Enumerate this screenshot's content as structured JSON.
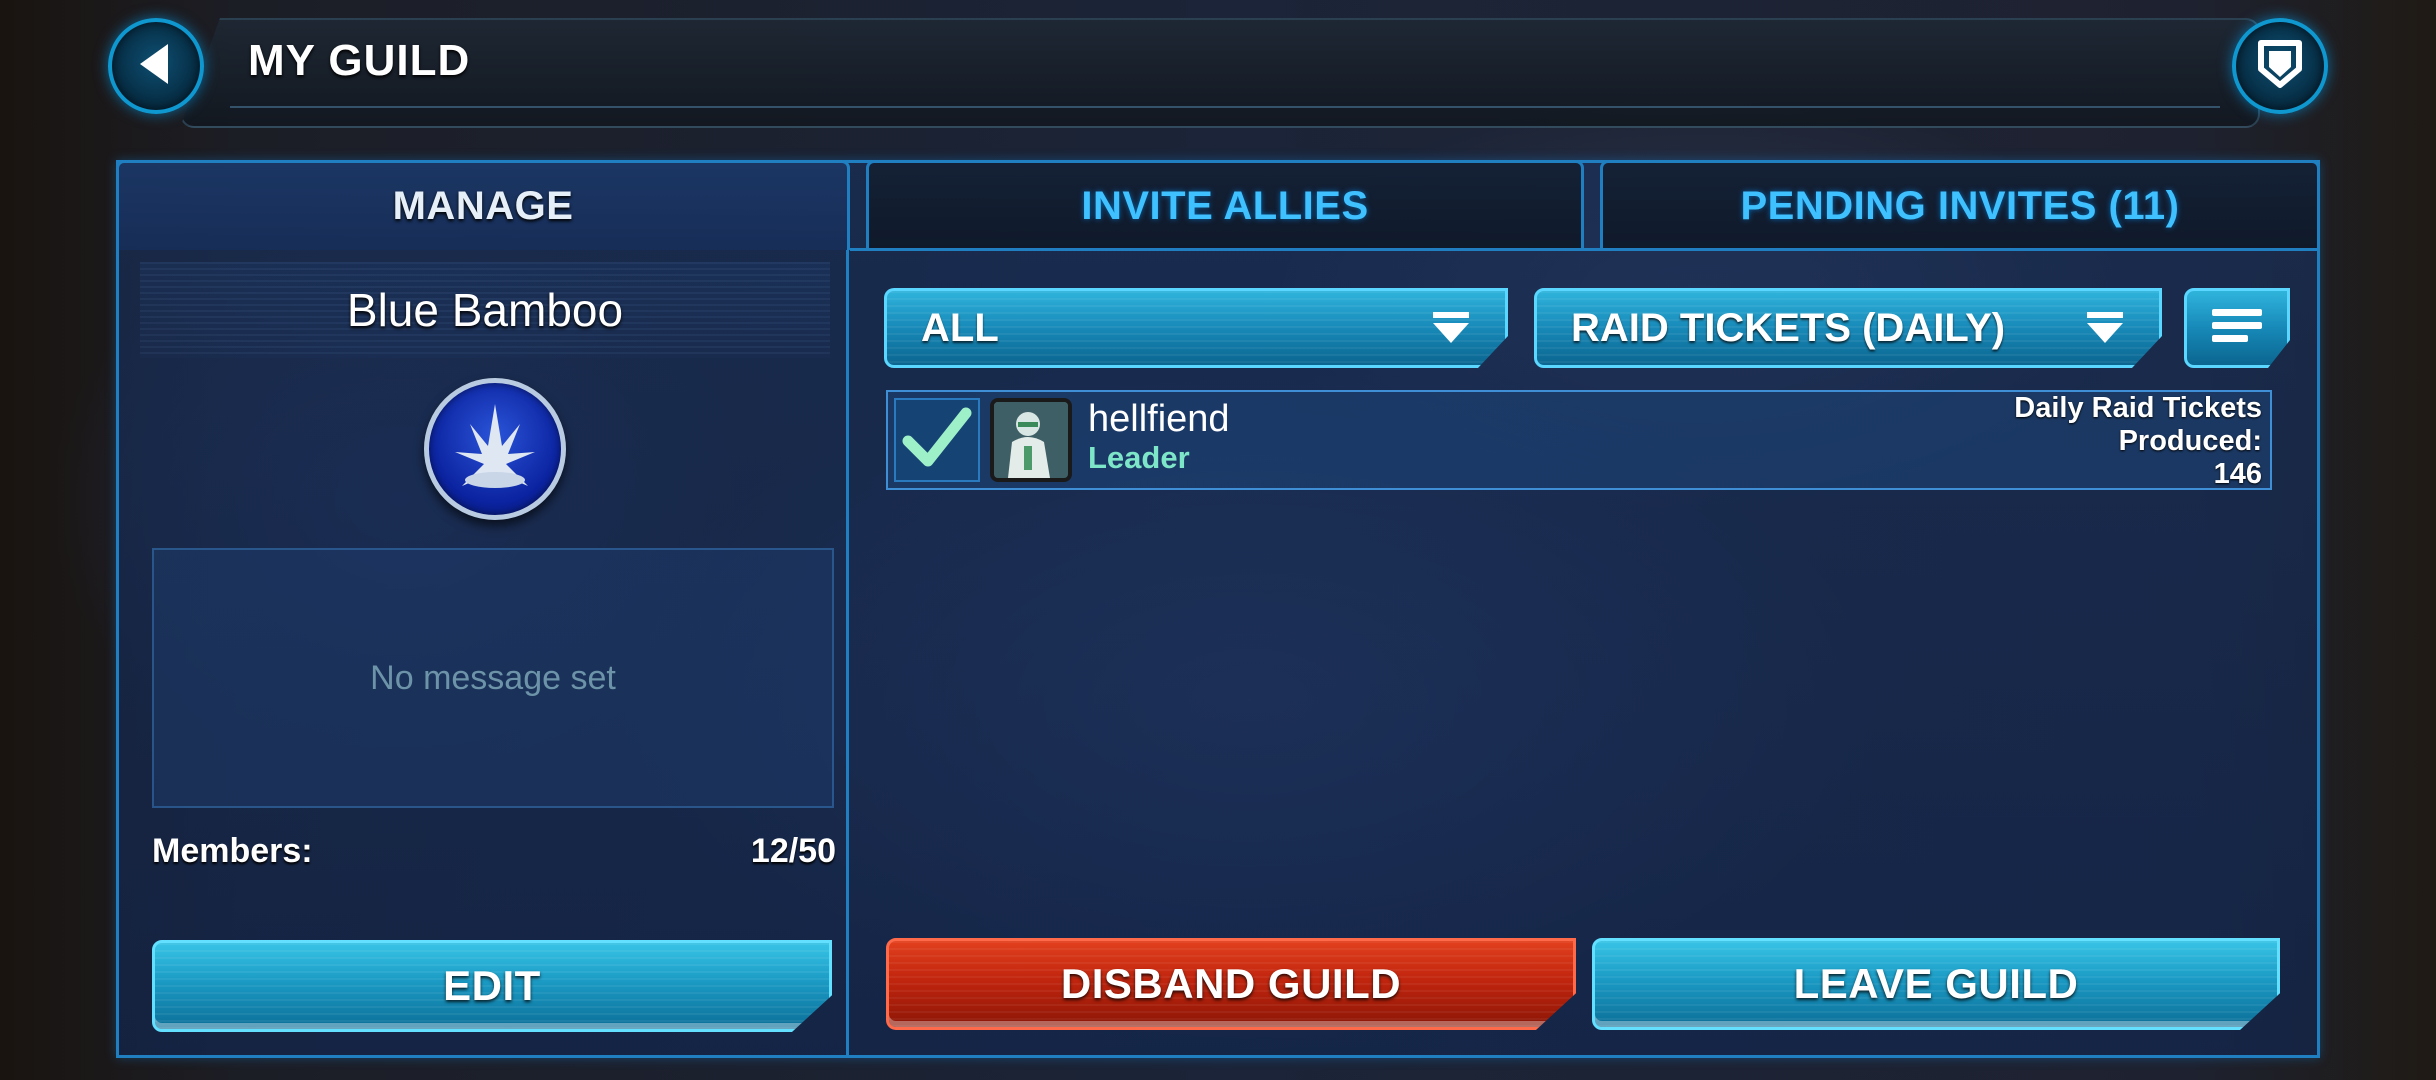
{
  "header": {
    "title": "MY GUILD",
    "back_icon": "back-arrow-icon",
    "shield_icon": "shield-icon"
  },
  "tabs": [
    {
      "label": "MANAGE",
      "active": true
    },
    {
      "label": "INVITE ALLIES",
      "active": false
    },
    {
      "label": "PENDING INVITES (11)",
      "active": false
    }
  ],
  "guild": {
    "name": "Blue Bamboo",
    "message": "No message set",
    "members_label": "Members:",
    "members_value": "12/50",
    "edit_label": "EDIT"
  },
  "filters": {
    "member_filter": "ALL",
    "sort_filter": "RAID TICKETS (DAILY)"
  },
  "members": [
    {
      "name": "hellfiend",
      "role": "Leader",
      "stat_line1": "Daily Raid Tickets",
      "stat_line2": "Produced:",
      "stat_value": "146"
    }
  ],
  "actions": {
    "disband_label": "DISBAND GUILD",
    "leave_label": "LEAVE GUILD"
  },
  "colors": {
    "accent": "#1f7fc0",
    "button_blue": "#1a9ac4",
    "button_red": "#c1250e",
    "tab_inactive_text": "#3fc0ff",
    "role_text": "#7ee6c8"
  }
}
